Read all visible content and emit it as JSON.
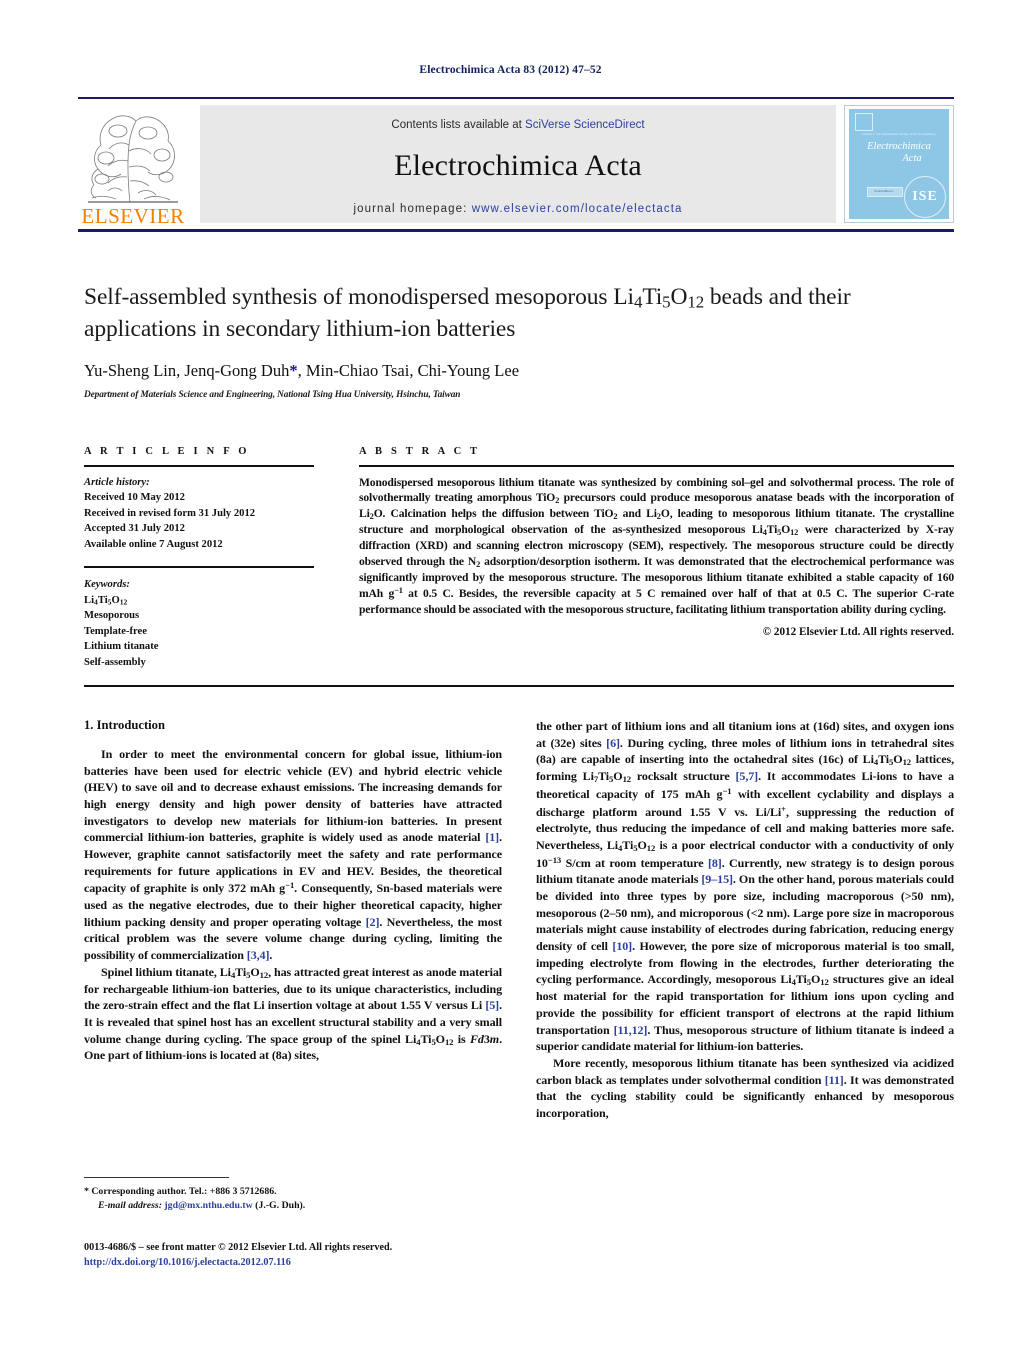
{
  "running_head": "Electrochimica Acta 83 (2012) 47–52",
  "masthead": {
    "contents_prefix": "Contents lists available at ",
    "contents_link": "SciVerse ScienceDirect",
    "journal_title": "Electrochimica Acta",
    "homepage_prefix": "journal homepage: ",
    "homepage_url": "www.elsevier.com/locate/electacta",
    "publisher_logo_text": "ELSEVIER",
    "cover": {
      "society_line": "Journal of the International Society of Electrochemistry",
      "title_line1": "Electrochimica",
      "title_line2": "Acta",
      "society_badge": "ISE",
      "box_label": "ScienceDirect"
    },
    "link_color": "#2b3f9e",
    "rule_color": "#1a1a6e",
    "banner_bg": "#e8e8e8"
  },
  "title_block": {
    "title_part1": "Self-assembled synthesis of monodispersed mesoporous Li",
    "title_sub1": "4",
    "title_part2": "Ti",
    "title_sub2": "5",
    "title_part3": "O",
    "title_sub3": "12",
    "title_part4": " beads and their applications in secondary lithium-ion batteries",
    "title_full": "Self-assembled synthesis of monodispersed mesoporous Li4Ti5O12 beads and their applications in secondary lithium-ion batteries",
    "authors_pre": "Yu-Sheng Lin, Jenq-Gong Duh",
    "corresponding_marker": "*",
    "authors_post": ", Min-Chiao Tsai, Chi-Young Lee",
    "affiliation": "Department of Materials Science and Engineering, National Tsing Hua University, Hsinchu, Taiwan"
  },
  "article_info": {
    "heading": "A R T I C L E   I N F O",
    "history_label": "Article history:",
    "history": [
      "Received 10 May 2012",
      "Received in revised form 31 July 2012",
      "Accepted 31 July 2012",
      "Available online 7 August 2012"
    ],
    "keywords_label": "Keywords:",
    "keywords_first": "Li4Ti5O12",
    "keywords": [
      "Mesoporous",
      "Template-free",
      "Lithium titanate",
      "Self-assembly"
    ]
  },
  "abstract": {
    "heading": "A B S T R A C T",
    "copyright": "© 2012 Elsevier Ltd. All rights reserved.",
    "text_full": "Monodispersed mesoporous lithium titanate was synthesized by combining sol–gel and solvothermal process. The role of solvothermally treating amorphous TiO2 precursors could produce mesoporous anatase beads with the incorporation of Li2O. Calcination helps the diffusion between TiO2 and Li2O, leading to mesoporous lithium titanate. The crystalline structure and morphological observation of the as-synthesized mesoporous Li4Ti5O12 were characterized by X-ray diffraction (XRD) and scanning electron microscopy (SEM), respectively. The mesoporous structure could be directly observed through the N2 adsorption/desorption isotherm. It was demonstrated that the electrochemical performance was significantly improved by the mesoporous structure. The mesoporous lithium titanate exhibited a stable capacity of 160 mAh g−1 at 0.5 C. Besides, the reversible capacity at 5 C remained over half of that at 0.5 C. The superior C-rate performance should be associated with the mesoporous structure, facilitating lithium transportation ability during cycling."
  },
  "body": {
    "section1_title": "1. Introduction",
    "left_paragraphs": [
      "In order to meet the environmental concern for global issue, lithium-ion batteries have been used for electric vehicle (EV) and hybrid electric vehicle (HEV) to save oil and to decrease exhaust emissions. The increasing demands for high energy density and high power density of batteries have attracted investigators to develop new materials for lithium-ion batteries. In present commercial lithium-ion batteries, graphite is widely used as anode material [1]. However, graphite cannot satisfactorily meet the safety and rate performance requirements for future applications in EV and HEV. Besides, the theoretical capacity of graphite is only 372 mAh g−1. Consequently, Sn-based materials were used as the negative electrodes, due to their higher theoretical capacity, higher lithium packing density and proper operating voltage [2]. Nevertheless, the most critical problem was the severe volume change during cycling, limiting the possibility of commercialization [3,4].",
      "Spinel lithium titanate, Li4Ti5O12, has attracted great interest as anode material for rechargeable lithium-ion batteries, due to its unique characteristics, including the zero-strain effect and the flat Li insertion voltage at about 1.55 V versus Li [5]. It is revealed that spinel host has an excellent structural stability and a very small volume change during cycling. The space group of the spinel Li4Ti5O12 is Fd3m. One part of lithium-ions is located at (8a) sites,"
    ],
    "right_paragraphs": [
      "the other part of lithium ions and all titanium ions at (16d) sites, and oxygen ions at (32e) sites [6]. During cycling, three moles of lithium ions in tetrahedral sites (8a) are capable of inserting into the octahedral sites (16c) of Li4Ti5O12 lattices, forming Li7Ti5O12 rocksalt structure [5,7]. It accommodates Li-ions to have a theoretical capacity of 175 mAh g−1 with excellent cyclability and displays a discharge platform around 1.55 V vs. Li/Li+, suppressing the reduction of electrolyte, thus reducing the impedance of cell and making batteries more safe. Nevertheless, Li4Ti5O12 is a poor electrical conductor with a conductivity of only 10−13 S/cm at room temperature [8]. Currently, new strategy is to design porous lithium titanate anode materials [9–15]. On the other hand, porous materials could be divided into three types by pore size, including macroporous (>50 nm), mesoporous (2–50 nm), and microporous (<2 nm). Large pore size in macroporous materials might cause instability of electrodes during fabrication, reducing energy density of cell [10]. However, the pore size of microporous material is too small, impeding electrolyte from flowing in the electrodes, further deteriorating the cycling performance. Accordingly, mesoporous Li4Ti5O12 structures give an ideal host material for the rapid transportation for lithium ions upon cycling and provide the possibility for efficient transport of electrons at the rapid lithium transportation [11,12]. Thus, mesoporous structure of lithium titanate is indeed a superior candidate material for lithium-ion batteries.",
      "More recently, mesoporous lithium titanate has been synthesized via acidized carbon black as templates under solvothermal condition [11]. It was demonstrated that the cycling stability could be significantly enhanced by mesoporous incorporation,"
    ]
  },
  "footnote": {
    "corresponding_marker": "*",
    "corresponding_text": " Corresponding author. Tel.: +886 3 5712686.",
    "email_label": "E-mail address:",
    "email": "jgd@mx.nthu.edu.tw",
    "email_suffix": " (J.-G. Duh)."
  },
  "imprint": {
    "line1": "0013-4686/$ – see front matter © 2012 Elsevier Ltd. All rights reserved.",
    "doi": "http://dx.doi.org/10.1016/j.electacta.2012.07.116"
  }
}
